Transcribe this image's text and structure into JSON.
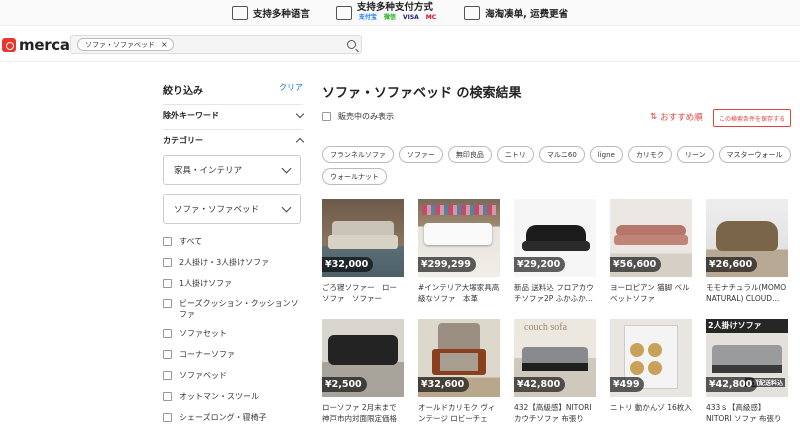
{
  "promo": {
    "language": "支持多种语言",
    "payment": "支持多种支付方式",
    "payment_logos": [
      "支付宝",
      "微信",
      "VISA",
      "MC"
    ],
    "shipping": "海淘凑单, 运费更省"
  },
  "header": {
    "logo": "mercari",
    "search_chip": "ソファ・ソファベッド",
    "search_chip_close": "×"
  },
  "sidebar": {
    "title": "絞り込み",
    "clear": "クリア",
    "exclude_keyword": "除外キーワード",
    "category": "カテゴリー",
    "select_1": "家具・インテリア",
    "select_2": "ソファ・ソファベッド",
    "items": [
      "すべて",
      "2人掛け・3人掛けソファ",
      "1人掛けソファ",
      "ビーズクッション・クッションソファ",
      "ソファセット",
      "コーナーソファ",
      "ソファベッド",
      "オットマン・スツール",
      "シェーズロング・寝椅子"
    ]
  },
  "main": {
    "title": "ソファ・ソファベッド の検索結果",
    "sold_only": "販売中のみ表示",
    "sort": "おすすめ順",
    "save_search": "この検索条件を保存する",
    "tags": [
      "フランネルソファ",
      "ソファー",
      "無印良品",
      "ニトリ",
      "マルニ60",
      "ligne",
      "カリモク",
      "リーン",
      "マスターウォール",
      "ウォールナット"
    ]
  },
  "products": [
    {
      "price": "¥32,000",
      "title": "ごろ寝ソファー　ローソファ　ソファー　ニ..."
    },
    {
      "price": "¥299,299",
      "title": "#インテリア大塚家具高級なソファ　本革　と..."
    },
    {
      "price": "¥29,200",
      "title": "新品 送料込 フロアカウチソファ2P ふかふか..."
    },
    {
      "price": "¥56,600",
      "title": "ヨーロピアン 猫脚 ベルベットソファ"
    },
    {
      "price": "¥26,600",
      "title": "モモナチュラル(MOMO NATURAL) CLOUD..."
    },
    {
      "price": "¥2,500",
      "title": "ローソファ 2月末まで神戸市内対面限定価格"
    },
    {
      "price": "¥32,600",
      "title": "オールドカリモク ヴィンテージ ロビーチェア..."
    },
    {
      "price": "¥42,800",
      "title": "432【高級感】NITORI カウチソファ 布張り フ..."
    },
    {
      "price": "¥499",
      "title": "ニトリ 動かんゾ 16枚入"
    },
    {
      "price": "¥42,800",
      "title": "433ｓ【高級感】NITORI ソファ 布張り ファブ..."
    }
  ],
  "overlays": {
    "couch_sofa": "couch sofa",
    "two_seat": "2人掛けソファ",
    "delivery": "設置配送料込"
  }
}
